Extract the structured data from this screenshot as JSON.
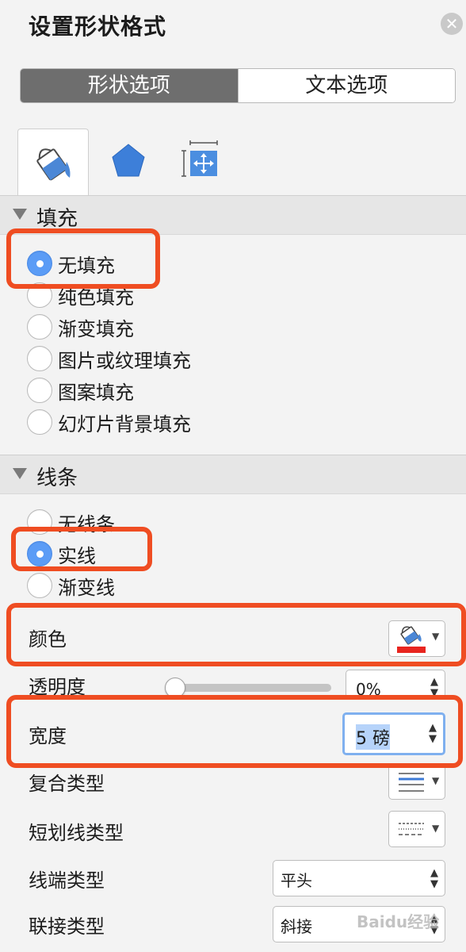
{
  "header": {
    "title": "设置形状格式",
    "close_glyph": "✕"
  },
  "segment": {
    "shape_options": "形状选项",
    "text_options": "文本选项"
  },
  "tabs": [
    {
      "name": "fill-line",
      "icon": "paint-bucket-icon"
    },
    {
      "name": "effects",
      "icon": "pentagon-icon"
    },
    {
      "name": "size-properties",
      "icon": "size-position-icon"
    }
  ],
  "fill": {
    "label": "填充",
    "options": [
      "无填充",
      "纯色填充",
      "渐变填充",
      "图片或纹理填充",
      "图案填充",
      "幻灯片背景填充"
    ],
    "selected": "无填充"
  },
  "line": {
    "label": "线条",
    "options": [
      "无线条",
      "实线",
      "渐变线"
    ],
    "selected": "实线",
    "color_label": "颜色",
    "color_value": "#e8251f",
    "transparency_label": "透明度",
    "transparency_value": "0%",
    "transparency_level": 0,
    "width_label": "宽度",
    "width_value": "5 磅",
    "compound_label": "复合类型",
    "dash_label": "短划线类型",
    "cap_label": "线端类型",
    "cap_value": "平头",
    "join_label": "联接类型",
    "join_value": "斜接"
  },
  "colors": {
    "accent": "#5b9cf6",
    "annotation": "#ef4d22"
  },
  "watermark": "Baidu经验"
}
